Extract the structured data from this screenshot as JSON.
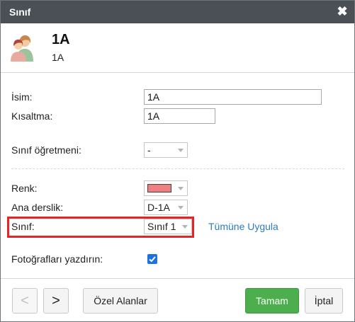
{
  "window": {
    "title": "Sınıf",
    "close_glyph": "✖"
  },
  "header": {
    "icon": "users-avatar-icon",
    "title": "1A",
    "subtitle": "1A"
  },
  "form": {
    "name_label": "İsim:",
    "name_value": "1A",
    "short_label": "Kısaltma:",
    "short_value": "1A",
    "teacher_label": "Sınıf öğretmeni:",
    "teacher_value": "-",
    "color_label": "Renk:",
    "color_value": "#f07f80",
    "classroom_label": "Ana derslik:",
    "classroom_value": "D-1A",
    "class_label": "Sınıf:",
    "class_value": "Sınıf 1",
    "apply_all_link": "Tümüne Uygula",
    "print_photos_label": "Fotoğrafları yazdırın:",
    "print_photos_checked": true
  },
  "footer": {
    "prev_label": "<",
    "next_label": ">",
    "custom_fields_label": "Özel Alanlar",
    "ok_label": "Tamam",
    "cancel_label": "İptal"
  },
  "colors": {
    "titlebar": "#4a5055",
    "ok_button": "#4cae4c",
    "link": "#2e7bbf",
    "highlight": "#e52525"
  }
}
